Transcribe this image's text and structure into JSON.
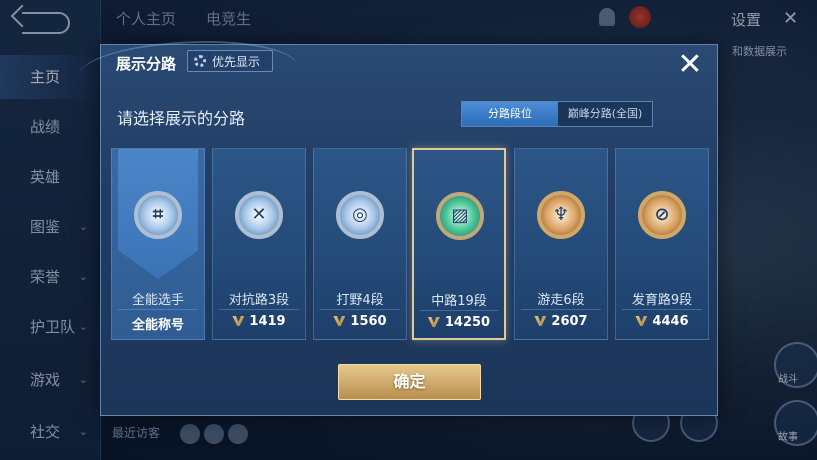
{
  "background": {
    "nav": [
      {
        "label": "主页",
        "active": true,
        "chevron": false
      },
      {
        "label": "战绩",
        "active": false,
        "chevron": false
      },
      {
        "label": "英雄",
        "active": false,
        "chevron": false
      },
      {
        "label": "图鉴",
        "active": false,
        "chevron": true
      },
      {
        "label": "荣誉",
        "active": false,
        "chevron": true
      },
      {
        "label": "护卫队",
        "active": false,
        "chevron": true
      },
      {
        "label": "游戏",
        "active": false,
        "chevron": true
      },
      {
        "label": "社交",
        "active": false,
        "chevron": true
      }
    ],
    "top_tabs": [
      "个人主页",
      "电竞生"
    ],
    "settings_label": "设置",
    "sub_label": "和数据展示",
    "recent_visitors": "最近访客",
    "right_labels": [
      "战斗",
      "故事"
    ]
  },
  "modal": {
    "title": "展示分路",
    "priority_label": "优先显示",
    "close_icon": "close-x",
    "prompt": "请选择展示的分路",
    "segmented": {
      "options": [
        "分路段位",
        "巅峰分路(全国)"
      ],
      "selected": "分路段位"
    },
    "cards": [
      {
        "role": "全能选手",
        "foot": "全能称号",
        "laurel": false,
        "emblem": "silver",
        "glyph": "⌗"
      },
      {
        "role": "对抗路3段",
        "foot": "1419",
        "laurel": true,
        "emblem": "silver",
        "glyph": "✕"
      },
      {
        "role": "打野4段",
        "foot": "1560",
        "laurel": true,
        "emblem": "silver",
        "glyph": "◎"
      },
      {
        "role": "中路19段",
        "foot": "14250",
        "laurel": true,
        "emblem": "green",
        "glyph": "▨"
      },
      {
        "role": "游走6段",
        "foot": "2607",
        "laurel": true,
        "emblem": "gold",
        "glyph": "♆"
      },
      {
        "role": "发育路9段",
        "foot": "4446",
        "laurel": true,
        "emblem": "gold",
        "glyph": "⊘"
      }
    ],
    "selected_index": 3,
    "confirm_label": "确定"
  }
}
